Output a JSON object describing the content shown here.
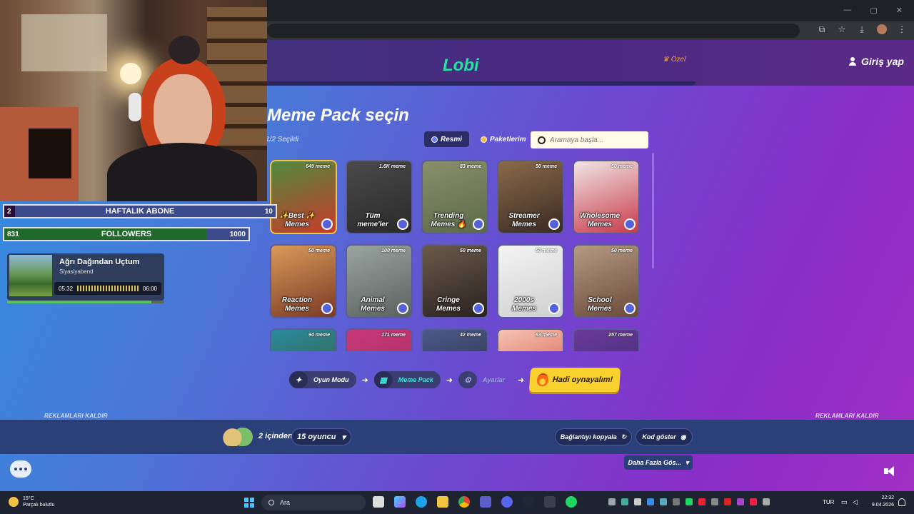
{
  "nav": {
    "logo": "Lobi",
    "special": "Özel",
    "login": "Giriş yap"
  },
  "lobby": {
    "pack_title": "Meme Pack seçin",
    "selected": "1/2 Seçildi",
    "tabs": [
      {
        "label": "Resmi",
        "active": true
      },
      {
        "label": "Paketlerim",
        "active": false
      }
    ],
    "search_placeholder": "Aramaya başla..."
  },
  "packs": [
    {
      "label": "✨Best ✨ Memes",
      "count": "649 meme",
      "selected": true,
      "colors": [
        "#4f8a3e",
        "#c93a2a"
      ]
    },
    {
      "label": "Tüm meme'ler",
      "count": "1.6K meme",
      "selected": false,
      "colors": [
        "#4a4a4a",
        "#2a2a2a"
      ]
    },
    {
      "label": "Trending Memes 🔥",
      "count": "83 meme",
      "selected": false,
      "colors": [
        "#8a8f6a",
        "#5a6a4a"
      ]
    },
    {
      "label": "Streamer Memes",
      "count": "50 meme",
      "selected": false,
      "colors": [
        "#8a6a4a",
        "#3a2a22"
      ]
    },
    {
      "label": "Wholesome Memes",
      "count": "50 meme",
      "selected": false,
      "colors": [
        "#f0e6e4",
        "#c83a4a"
      ]
    },
    {
      "label": "Reaction Memes",
      "count": "50 meme",
      "selected": false,
      "colors": [
        "#d99a5a",
        "#7a3a24"
      ]
    },
    {
      "label": "Animal Memes",
      "count": "100 meme",
      "selected": false,
      "colors": [
        "#9aa4a0",
        "#5a6260"
      ]
    },
    {
      "label": "Cringe Memes",
      "count": "50 meme",
      "selected": false,
      "colors": [
        "#6a5a4a",
        "#2a2220"
      ]
    },
    {
      "label": "2000s Memes",
      "count": "50 meme",
      "selected": false,
      "colors": [
        "#f4f4f4",
        "#cfcfcf"
      ]
    },
    {
      "label": "School Memes",
      "count": "50 meme",
      "selected": false,
      "colors": [
        "#b59a82",
        "#6a4a3a"
      ]
    },
    {
      "label": "",
      "count": "94 meme",
      "selected": false,
      "colors": [
        "#2a8aa0",
        "#3a5a2a"
      ]
    },
    {
      "label": "",
      "count": "171 meme",
      "selected": false,
      "colors": [
        "#c83a7a",
        "#a02a5a"
      ]
    },
    {
      "label": "",
      "count": "42 meme",
      "selected": false,
      "colors": [
        "#4a5a8a",
        "#2a2a3a"
      ]
    },
    {
      "label": "",
      "count": "53 meme",
      "selected": false,
      "colors": [
        "#f4c4b4",
        "#d44a3a"
      ]
    },
    {
      "label": "",
      "count": "257 meme",
      "selected": false,
      "colors": [
        "#6a3a9a",
        "#3a2a6a"
      ]
    }
  ],
  "steps": {
    "mode": "Oyun Modu",
    "pack": "Meme Pack",
    "settings": "Ayarlar",
    "play": "Hadi oynayalım!"
  },
  "ads": {
    "left": "REKLAMLARI KALDIR",
    "right": "REKLAMLARI KALDIR"
  },
  "bottom": {
    "of_two": "2 içinden",
    "players": "15 oyuncu",
    "copy_link": "Bağlantıyı kopyala",
    "show_code": "Kod göster",
    "more": "Daha Fazla Gös..."
  },
  "overlay": {
    "subs": {
      "left": "2",
      "title": "HAFTALIK ABONE",
      "right": "10",
      "progress": 0.2
    },
    "followers": {
      "left": "831",
      "title": "FOLLOWERS",
      "right": "1000",
      "progress": 0.831
    },
    "music": {
      "title": "Ağrı Dağından Uçtum",
      "artist": "Siyasiyabend",
      "elapsed": "05:32",
      "total": "06:00",
      "progress": 0.92
    }
  },
  "taskbar": {
    "temp": "15°C",
    "weather": "Parçalı bulutlu",
    "search": "Ara",
    "lang": "TUR",
    "time": "22:32",
    "date": "9.04.2026"
  },
  "colors": {
    "accent_green": "#22e3a0",
    "play_yellow": "#f8d12f",
    "gold_border": "#f6c445"
  }
}
